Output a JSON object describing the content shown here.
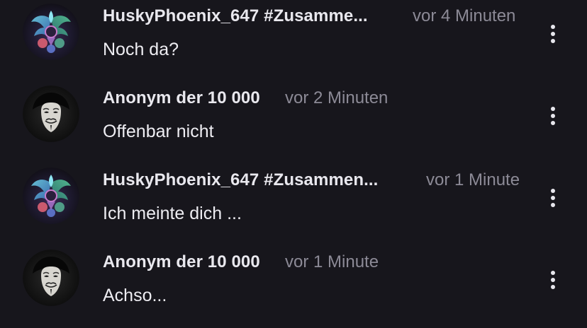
{
  "colors": {
    "background": "#17161c",
    "author_text": "#e9e8ee",
    "timestamp_text": "#8c8a96",
    "comment_text": "#eeedf2"
  },
  "comments": [
    {
      "author": "HuskyPhoenix_647 #Zusamme...",
      "time": "vor 4 Minuten",
      "text": "Noch da?",
      "avatar_icon": "phoenix-emblem-icon",
      "menu_icon": "more-vertical-icon"
    },
    {
      "author": "Anonym der 10 000",
      "time": "vor 2 Minuten",
      "text": "Offenbar nicht",
      "avatar_icon": "guy-fawkes-mask-icon",
      "menu_icon": "more-vertical-icon"
    },
    {
      "author": "HuskyPhoenix_647 #Zusammen...",
      "time": "vor 1 Minute",
      "text": "Ich meinte dich ...",
      "avatar_icon": "phoenix-emblem-icon",
      "menu_icon": "more-vertical-icon"
    },
    {
      "author": "Anonym der 10 000",
      "time": "vor 1 Minute",
      "text": "Achso...",
      "avatar_icon": "guy-fawkes-mask-icon",
      "menu_icon": "more-vertical-icon"
    }
  ]
}
